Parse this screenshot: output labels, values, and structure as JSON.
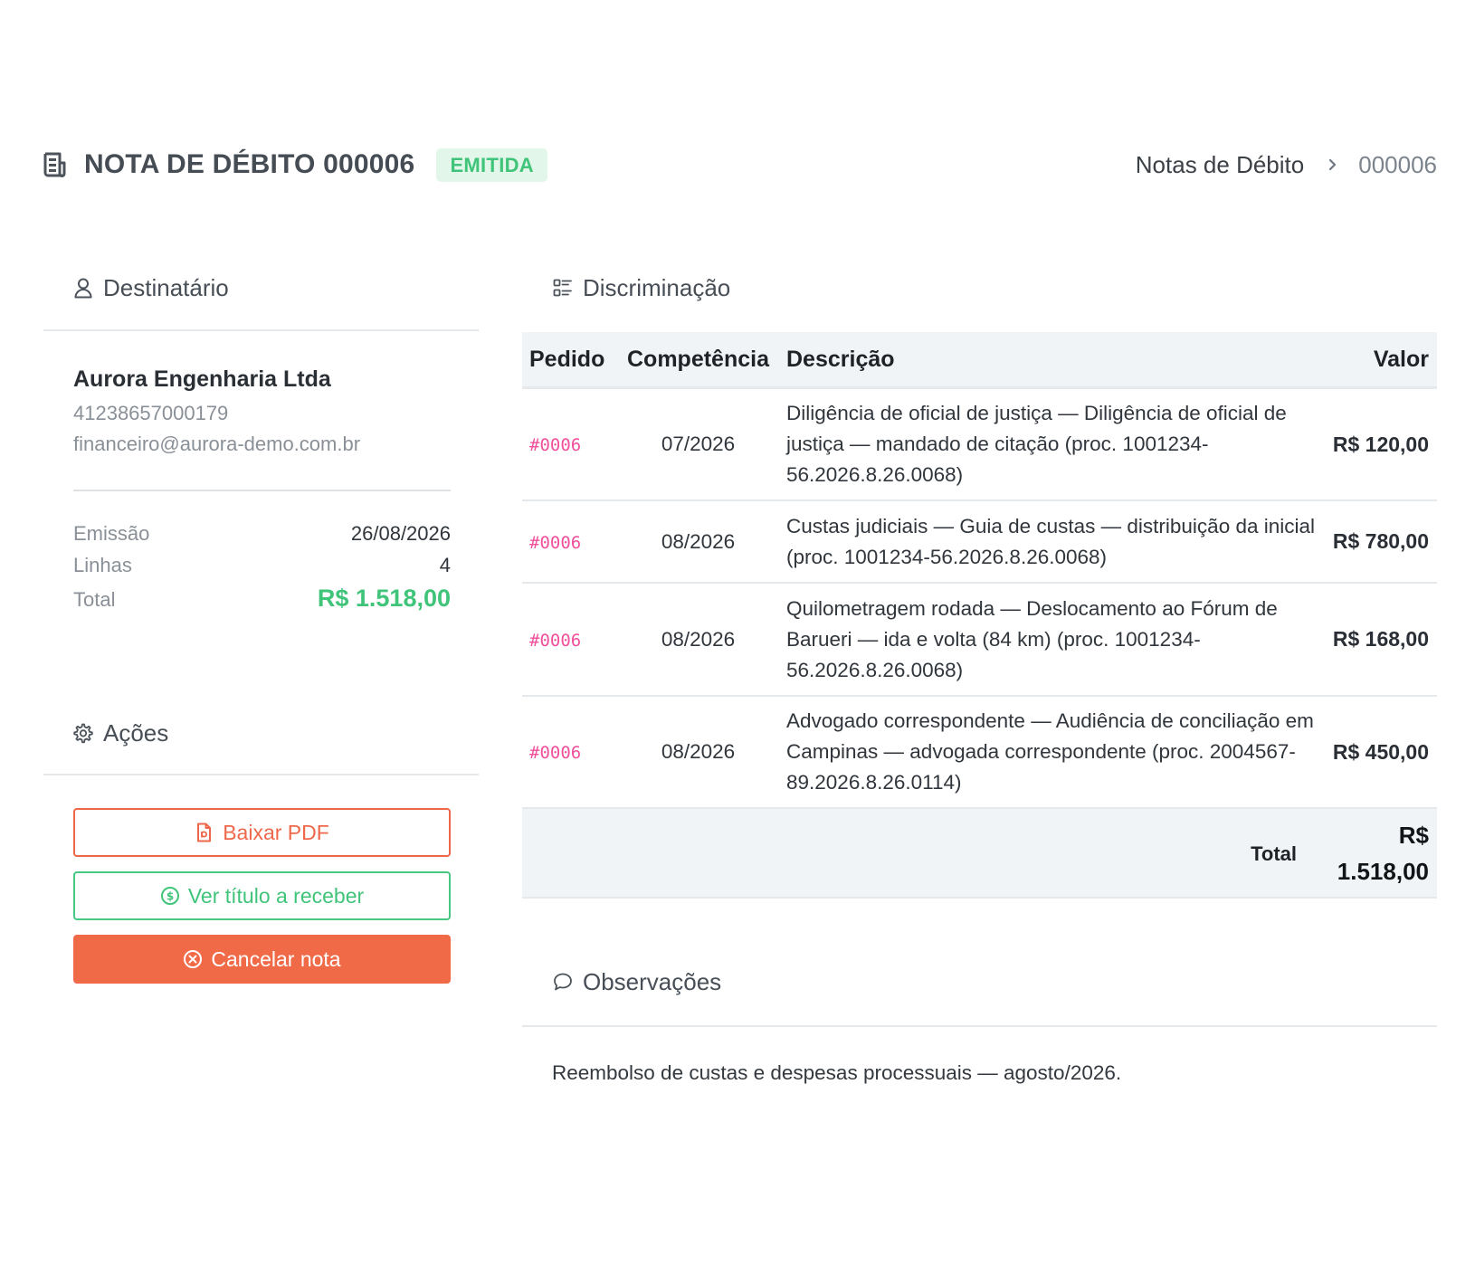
{
  "header": {
    "title": "NOTA DE DÉBITO 000006",
    "status": "EMITIDA",
    "breadcrumb": {
      "parent": "Notas de Débito",
      "current": "000006"
    }
  },
  "recipient": {
    "section_title": "Destinatário",
    "name": "Aurora Engenharia Ltda",
    "document": "41238657000179",
    "email": "financeiro@aurora-demo.com.br",
    "meta": {
      "emissao_label": "Emissão",
      "emissao_value": "26/08/2026",
      "linhas_label": "Linhas",
      "linhas_value": "4",
      "total_label": "Total",
      "total_value": "R$ 1.518,00"
    }
  },
  "actions": {
    "section_title": "Ações",
    "download_pdf": "Baixar PDF",
    "view_receivable": "Ver título a receber",
    "cancel_note": "Cancelar nota"
  },
  "items": {
    "section_title": "Discriminação",
    "columns": [
      "Pedido",
      "Competência",
      "Descrição",
      "Valor"
    ],
    "rows": [
      {
        "order": "#0006",
        "competence": "07/2026",
        "description": "Diligência de oficial de justiça — Diligência de oficial de justiça — mandado de citação (proc. 1001234-56.2026.8.26.0068)",
        "value": "R$ 120,00"
      },
      {
        "order": "#0006",
        "competence": "08/2026",
        "description": "Custas judiciais — Guia de custas — distribuição da inicial (proc. 1001234-56.2026.8.26.0068)",
        "value": "R$ 780,00"
      },
      {
        "order": "#0006",
        "competence": "08/2026",
        "description": "Quilometragem rodada — Deslocamento ao Fórum de Barueri — ida e volta (84 km) (proc. 1001234-56.2026.8.26.0068)",
        "value": "R$ 168,00"
      },
      {
        "order": "#0006",
        "competence": "08/2026",
        "description": "Advogado correspondente — Audiência de conciliação em Campinas — advogada correspondente (proc. 2004567-89.2026.8.26.0114)",
        "value": "R$ 450,00"
      }
    ],
    "total_label": "Total",
    "total_value": "R$ 1.518,00"
  },
  "notes": {
    "section_title": "Observações",
    "text": "Reembolso de custas e despesas processuais — agosto/2026."
  },
  "colors": {
    "accent_green": "#3fc47a",
    "accent_red": "#f06a47",
    "order_pink": "#f0509b"
  }
}
